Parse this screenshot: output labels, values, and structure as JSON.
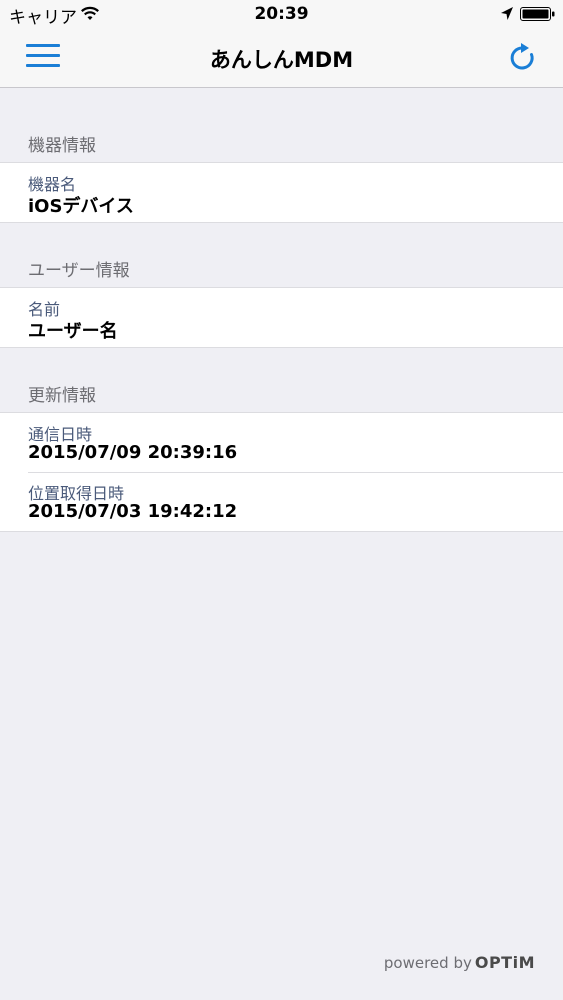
{
  "status_bar": {
    "carrier": "キャリア",
    "time": "20:39"
  },
  "nav": {
    "title": "あんしんMDM",
    "menu_icon": "hamburger-menu-icon",
    "refresh_icon": "refresh-icon"
  },
  "sections": [
    {
      "header": "機器情報",
      "rows": [
        {
          "label": "機器名",
          "value": "iOSデバイス"
        }
      ]
    },
    {
      "header": "ユーザー情報",
      "rows": [
        {
          "label": "名前",
          "value": "ユーザー名"
        }
      ]
    },
    {
      "header": "更新情報",
      "rows": [
        {
          "label": "通信日時",
          "value": "2015/07/09 20:39:16"
        },
        {
          "label": "位置取得日時",
          "value": "2015/07/03 19:42:12"
        }
      ]
    }
  ],
  "footer": {
    "powered_by": "powered by",
    "brand": "OPTiM"
  },
  "colors": {
    "accent": "#1a7ed6",
    "background": "#efeff4",
    "section_header": "#6d6d72"
  }
}
